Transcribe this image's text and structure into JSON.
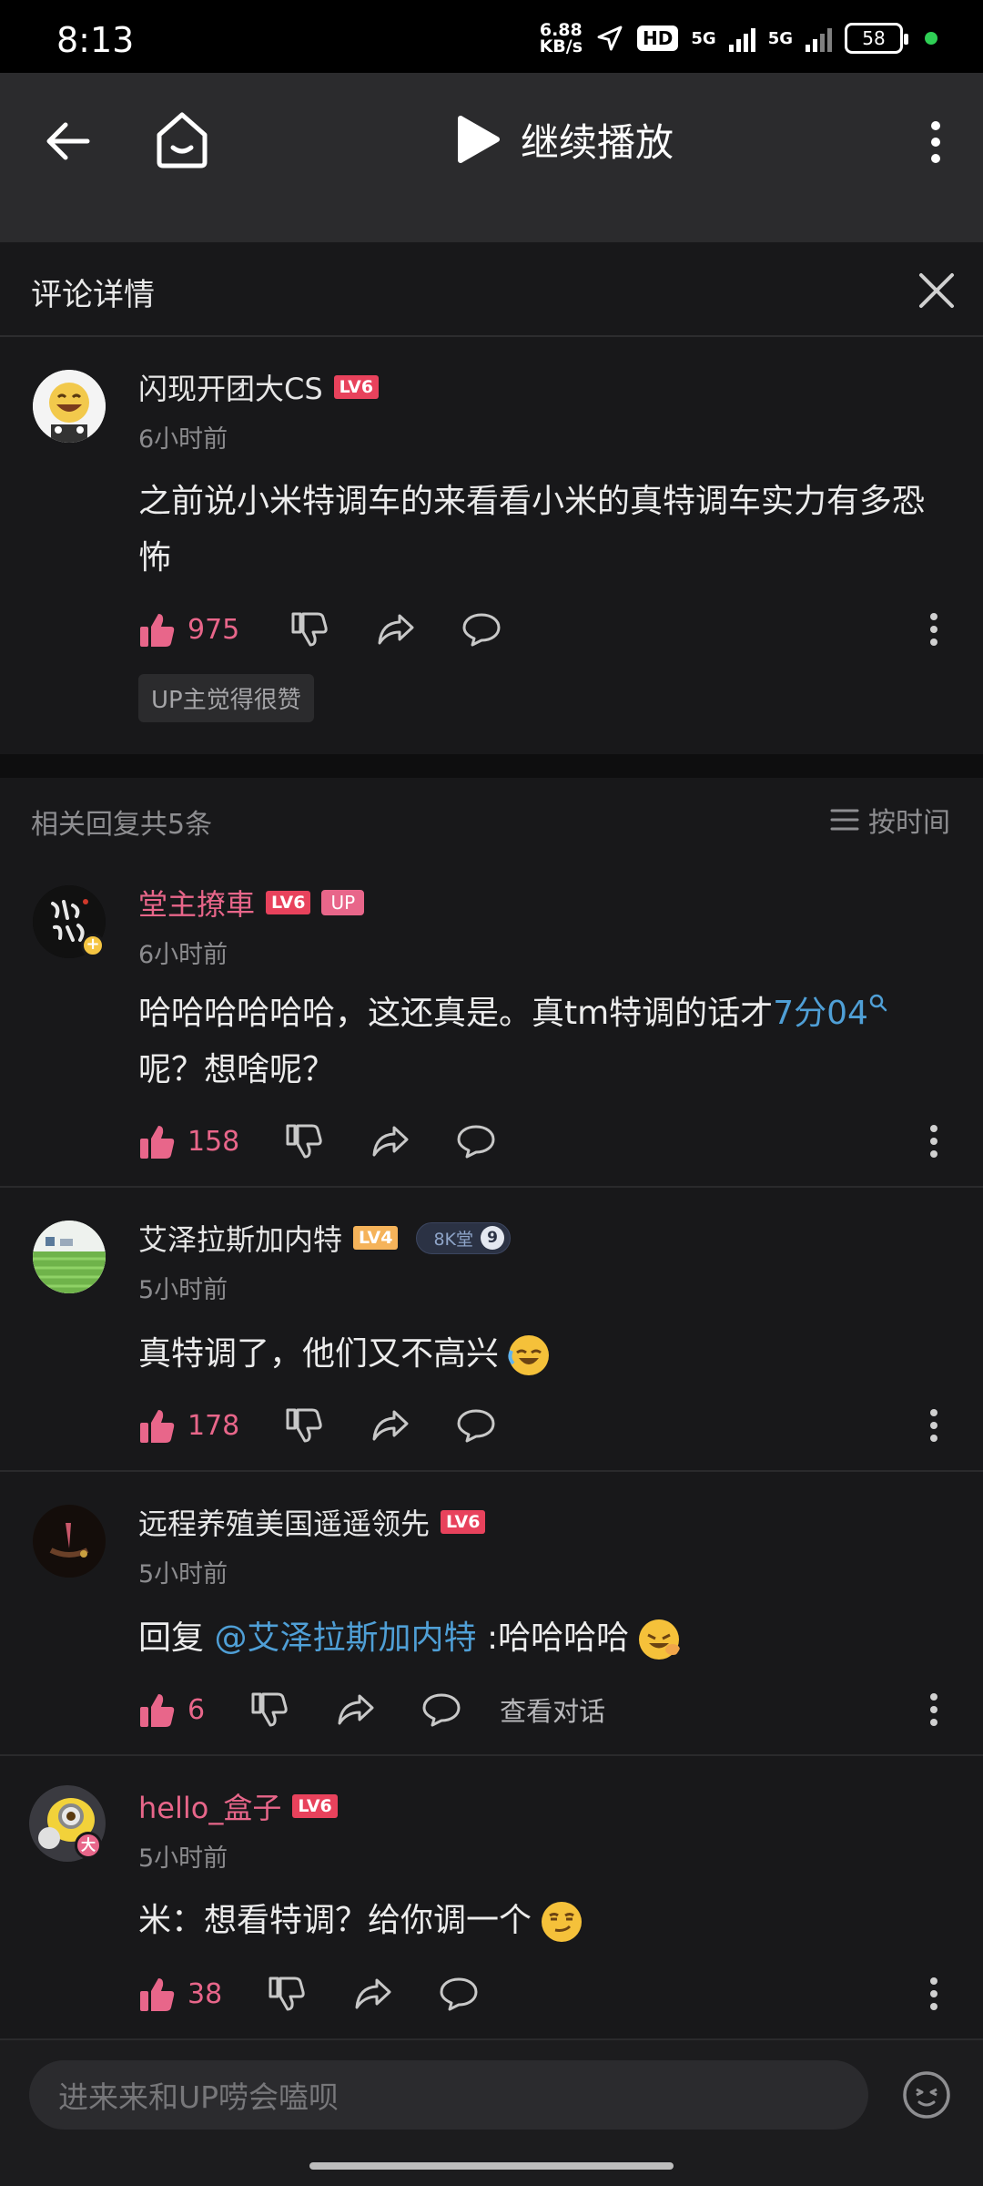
{
  "status_bar": {
    "time": "8:13",
    "net_speed_value": "6.88",
    "net_speed_unit": "KB/s",
    "hd_badge": "HD",
    "signal1": "5G",
    "signal2": "5G",
    "battery": "58"
  },
  "video_bar": {
    "continue_label": "继续播放"
  },
  "detail": {
    "title": "评论详情"
  },
  "main_comment": {
    "username": "闪现开团大CS",
    "level": "LV6",
    "time": "6小时前",
    "text": "之前说小米特调车的来看看小米的真特调车实力有多恐怖",
    "likes": "975",
    "up_liked": "UP主觉得很赞"
  },
  "replies_header": {
    "count_label": "相关回复共5条",
    "sort_label": "按时间"
  },
  "replies": [
    {
      "username": "堂主撩車",
      "level": "LV6",
      "up_badge": "UP",
      "time": "6小时前",
      "text_before": "哈哈哈哈哈哈，这还真是。真tm特调的话才",
      "text_link": "7分04",
      "text_after": "呢？想啥呢？",
      "likes": "158"
    },
    {
      "username": "艾泽拉斯加内特",
      "level": "LV4",
      "fan_badge": "8K堂",
      "fan_level": "9",
      "time": "5小时前",
      "text": "真特调了，他们又不高兴",
      "likes": "178"
    },
    {
      "username": "远程养殖美国遥遥领先",
      "level": "LV6",
      "time": "5小时前",
      "reply_prefix": "回复",
      "mention": "@艾泽拉斯加内特",
      "text": ":哈哈哈哈",
      "likes": "6",
      "view_conversation": "查看对话"
    },
    {
      "username": "hello_盒子",
      "level": "LV6",
      "time": "5小时前",
      "text": "米：想看特调？给你调一个",
      "likes": "38"
    }
  ],
  "input": {
    "placeholder": "进来来和UP唠会嗑呗"
  },
  "avatar_badges": {
    "reply1": "+",
    "reply4": "大"
  }
}
